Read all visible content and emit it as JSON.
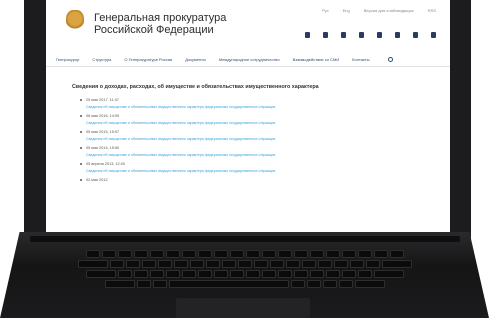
{
  "site": {
    "title_line1": "Генеральная прокуратура",
    "title_line2": "Российской Федерации",
    "top_links": [
      "Рус",
      "Eng",
      "Версия для слабовидящих",
      "RSS"
    ]
  },
  "nav": [
    "Генпрокурор",
    "Структура",
    "О Генпрокуратуре России",
    "Документы",
    "Международное сотрудничество",
    "Взаимодействие со СМИ",
    "Контакты"
  ],
  "page": {
    "heading": "Сведения о доходах, расходах, об имуществе и обязательствах имущественного характера",
    "entries": [
      {
        "date": "25 мая 2017, 11:37",
        "link": "Сведения об имуществе и обязательствах имущественного характера федеральных государственных служащих"
      },
      {
        "date": "06 мая 2016, 14:09",
        "link": "Сведения об имуществе и обязательствах имущественного характера федеральных государственных служащих"
      },
      {
        "date": "05 мая 2015, 15:57",
        "link": "Сведения об имуществе и обязательствах имущественного характера федеральных государственных служащих"
      },
      {
        "date": "05 мая 2014, 15:50",
        "link": "Сведения об имуществе и обязательствах имущественного характера федеральных государственных служащих"
      },
      {
        "date": "05 апреля 2013, 12:00",
        "link": "Сведения об имуществе и обязательствах имущественного характера федеральных государственных служащих"
      },
      {
        "date": "02 мая 2012",
        "link": ""
      }
    ]
  }
}
